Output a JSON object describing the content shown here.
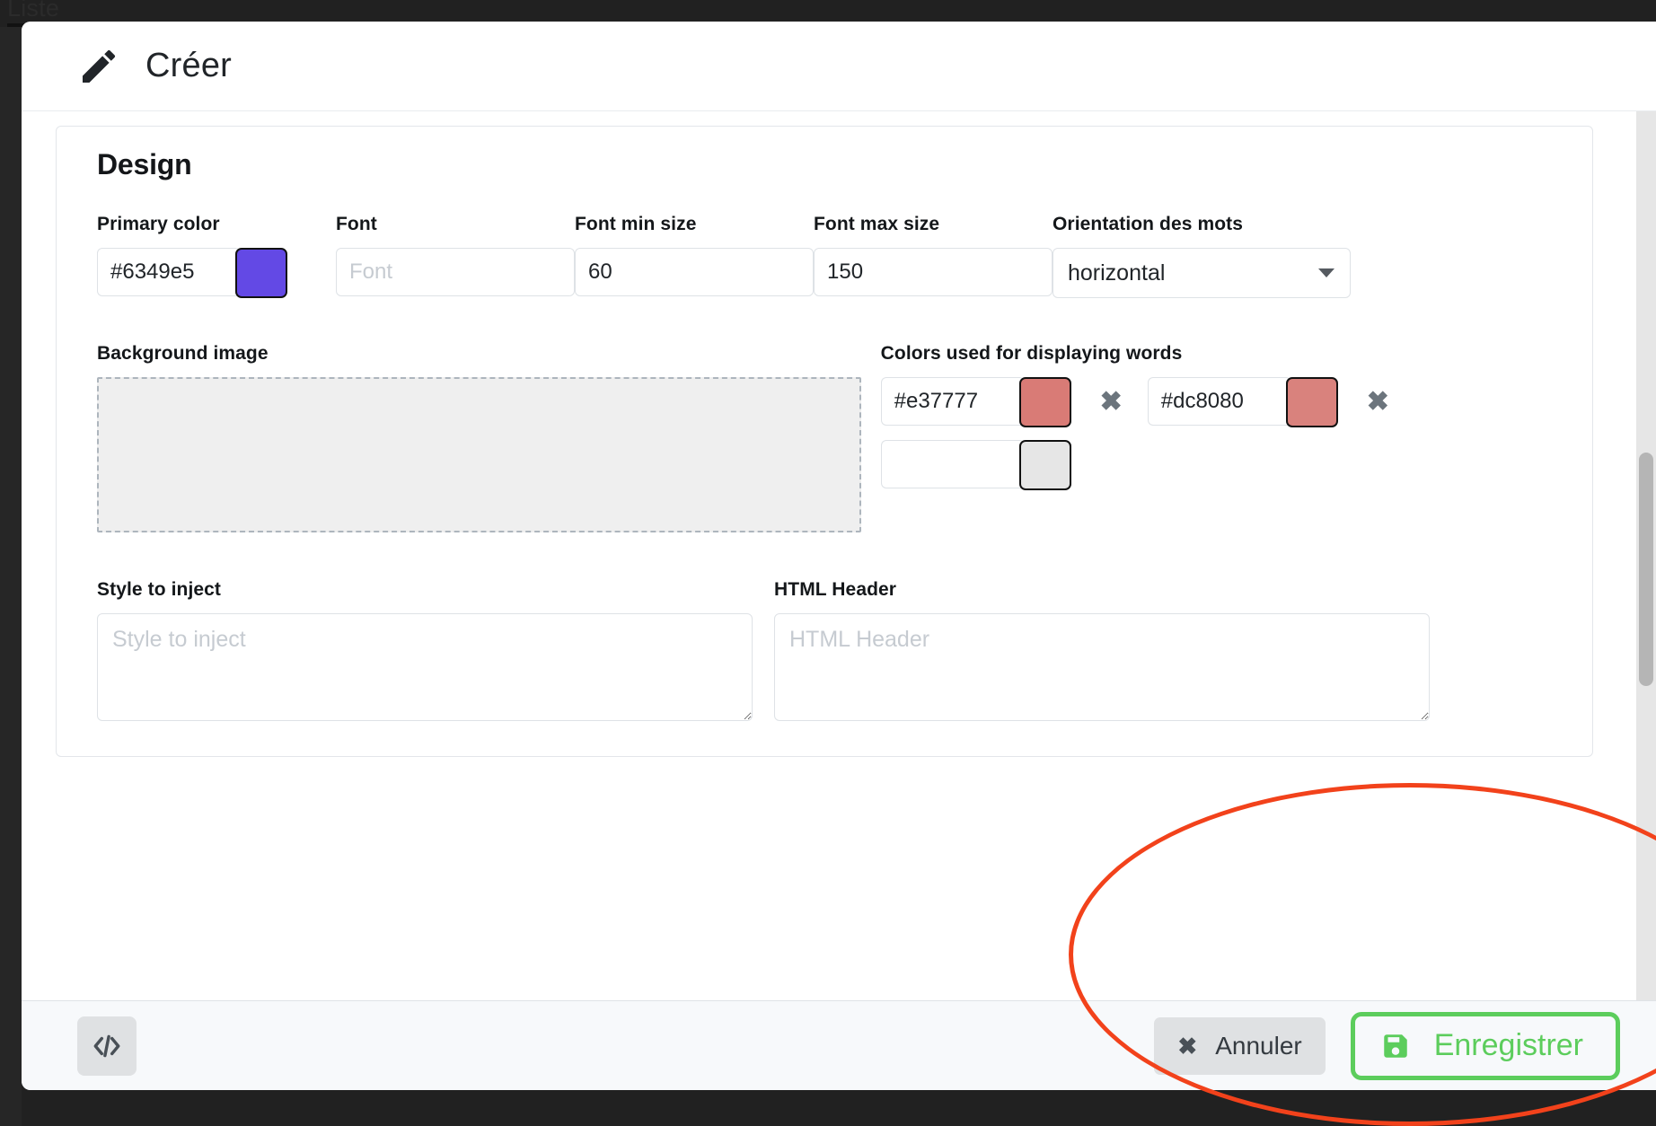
{
  "background": {
    "page_tab_label": "Liste"
  },
  "modal": {
    "title": "Créer",
    "icon": "pencil-icon",
    "section": {
      "title": "Design",
      "fields": {
        "primary_color": {
          "label": "Primary color",
          "value": "#6349e5",
          "swatch_color": "#6349e5"
        },
        "font": {
          "label": "Font",
          "value": "",
          "placeholder": "Font"
        },
        "font_min_size": {
          "label": "Font min size",
          "value": "60"
        },
        "font_max_size": {
          "label": "Font max size",
          "value": "150"
        },
        "orientation": {
          "label": "Orientation des mots",
          "value": "horizontal",
          "caret_icon": "chevron-down-icon"
        },
        "background_image": {
          "label": "Background image",
          "dropzone_text": ""
        },
        "word_colors": {
          "label": "Colors used for displaying words",
          "remove_icon": "close-icon",
          "items": [
            {
              "value": "#e37777",
              "swatch_color": "#d97b76",
              "removable": true
            },
            {
              "value": "#dc8080",
              "swatch_color": "#d9827d",
              "removable": true
            },
            {
              "value": "",
              "swatch_color": "#e6e6e6",
              "removable": false
            }
          ]
        },
        "style_to_inject": {
          "label": "Style to inject",
          "value": "",
          "placeholder": "Style to inject"
        },
        "html_header": {
          "label": "HTML Header",
          "value": "",
          "placeholder": "HTML Header"
        }
      }
    },
    "footer": {
      "code_button": {
        "icon": "code-icon",
        "label": ""
      },
      "cancel_button": {
        "label": "Annuler",
        "icon": "close-icon"
      },
      "save_button": {
        "label": "Enregistrer",
        "icon": "save-icon"
      }
    }
  },
  "annotation": {
    "shape": "circle",
    "color": "#f2421b",
    "target": "Enregistrer"
  }
}
